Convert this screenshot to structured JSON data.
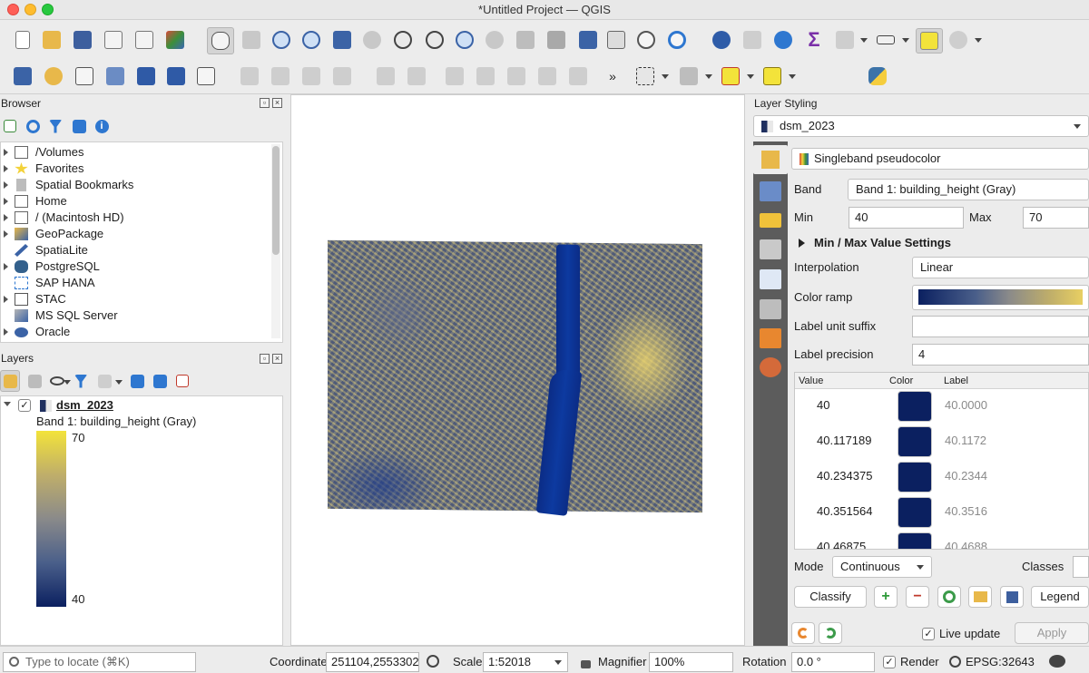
{
  "window": {
    "title": "*Untitled Project — QGIS"
  },
  "browser": {
    "title": "Browser",
    "items": [
      {
        "label": "/Volumes",
        "icon": "folder-icon"
      },
      {
        "label": "Favorites",
        "icon": "star-icon"
      },
      {
        "label": "Spatial Bookmarks",
        "icon": "bookmark-icon"
      },
      {
        "label": "Home",
        "icon": "home-folder-icon"
      },
      {
        "label": "/ (Macintosh HD)",
        "icon": "folder-icon"
      },
      {
        "label": "GeoPackage",
        "icon": "geopackage-icon"
      },
      {
        "label": "SpatiaLite",
        "icon": "spatialite-icon"
      },
      {
        "label": "PostgreSQL",
        "icon": "postgresql-icon"
      },
      {
        "label": "SAP HANA",
        "icon": "sap-hana-icon"
      },
      {
        "label": "STAC",
        "icon": "stac-icon"
      },
      {
        "label": "MS SQL Server",
        "icon": "mssql-icon"
      },
      {
        "label": "Oracle",
        "icon": "oracle-icon"
      }
    ]
  },
  "layers": {
    "title": "Layers",
    "layer_name": "dsm_2023",
    "layer_checked": true,
    "band_label": "Band 1: building_height (Gray)",
    "legend_max": "70",
    "legend_min": "40"
  },
  "styling": {
    "title": "Layer Styling",
    "layer_select": "dsm_2023",
    "renderer": "Singleband pseudocolor",
    "band_label": "Band",
    "band_value": "Band 1: building_height (Gray)",
    "min_label": "Min",
    "min_value": "40",
    "max_label": "Max",
    "max_value": "70",
    "minmax_settings": "Min / Max Value Settings",
    "interpolation_label": "Interpolation",
    "interpolation_value": "Linear",
    "color_ramp_label": "Color ramp",
    "label_unit_suffix_label": "Label unit suffix",
    "label_unit_suffix_value": "",
    "label_precision_label": "Label precision",
    "label_precision_value": "4",
    "table_headers": {
      "value": "Value",
      "color": "Color",
      "label": "Label"
    },
    "rows": [
      {
        "value": "40",
        "label": "40.0000"
      },
      {
        "value": "40.117189",
        "label": "40.1172"
      },
      {
        "value": "40.234375",
        "label": "40.2344"
      },
      {
        "value": "40.351564",
        "label": "40.3516"
      },
      {
        "value": "40.46875",
        "label": "40.4688"
      }
    ],
    "mode_label": "Mode",
    "mode_value": "Continuous",
    "classes_label": "Classes",
    "classify_button": "Classify",
    "legend_button": "Legend",
    "live_update_label": "Live update",
    "live_update_checked": true,
    "apply_button": "Apply"
  },
  "statusbar": {
    "locate_placeholder": "Type to locate (⌘K)",
    "coordinate_label": "Coordinate",
    "coordinate_value": "251104,2553302",
    "scale_label": "Scale",
    "scale_value": "1:52018",
    "magnifier_label": "Magnifier",
    "magnifier_value": "100%",
    "rotation_label": "Rotation",
    "rotation_value": "0.0 °",
    "render_label": "Render",
    "render_checked": true,
    "crs_value": "EPSG:32643"
  },
  "colors": {
    "ramp_low": "#0b2060",
    "ramp_high": "#e8cf63",
    "accent": "#f3e33a"
  }
}
